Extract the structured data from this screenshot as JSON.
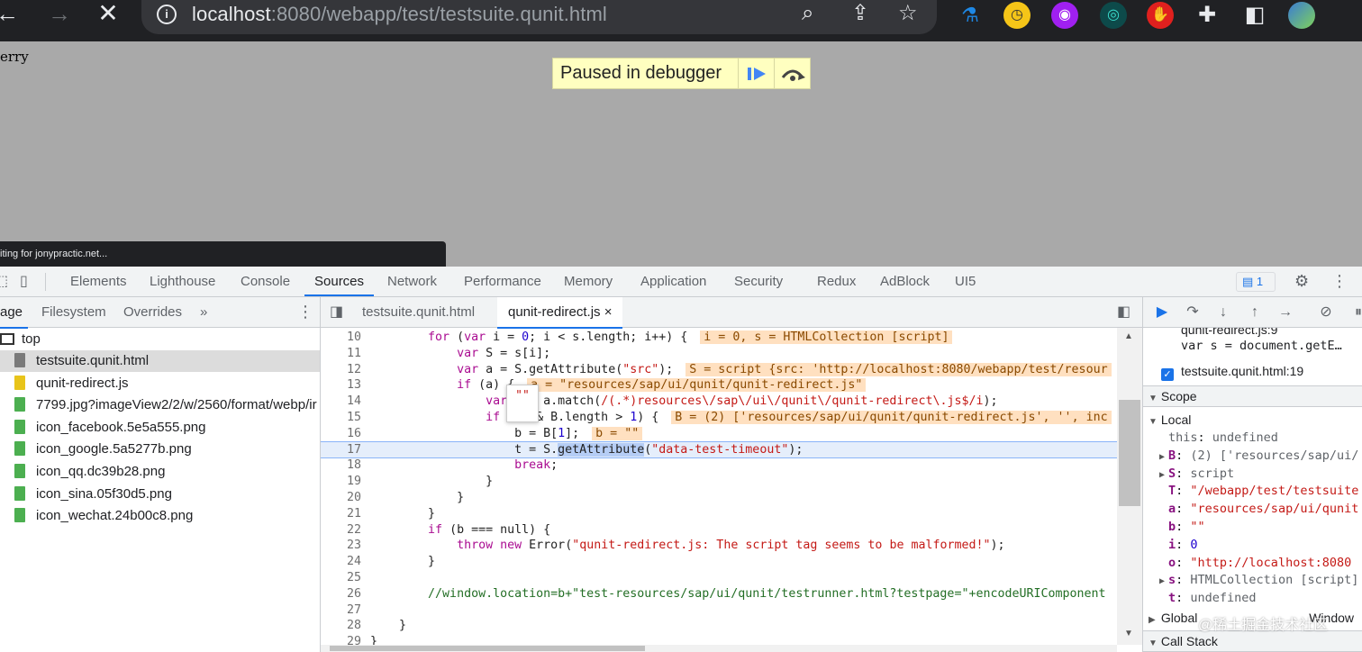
{
  "browser": {
    "url_host": "localhost",
    "url_rest": ":8080/webapp/test/testsuite.qunit.html",
    "back_icon": "back-arrow-icon",
    "forward_icon": "forward-arrow-icon",
    "stop_icon": "close-icon"
  },
  "page": {
    "text": "erry",
    "debugger_banner": "Paused in debugger",
    "status_text": "iting for jonypractic.net..."
  },
  "devtools": {
    "tabs": [
      "Elements",
      "Lighthouse",
      "Console",
      "Sources",
      "Network",
      "Performance",
      "Memory",
      "Application",
      "Security",
      "Redux",
      "AdBlock",
      "UI5"
    ],
    "active_tab": "Sources",
    "issues_count": "1"
  },
  "navigator": {
    "tabs": [
      "age",
      "Filesystem",
      "Overrides",
      "»"
    ],
    "root": "top",
    "files": [
      {
        "name": "testsuite.qunit.html",
        "type": "html",
        "selected": true
      },
      {
        "name": "qunit-redirect.js",
        "type": "js",
        "selected": false
      },
      {
        "name": "7799.jpg?imageView2/2/w/2560/format/webp/ir",
        "type": "img",
        "selected": false
      },
      {
        "name": "icon_facebook.5e5a555.png",
        "type": "img",
        "selected": false
      },
      {
        "name": "icon_google.5a5277b.png",
        "type": "img",
        "selected": false
      },
      {
        "name": "icon_qq.dc39b28.png",
        "type": "img",
        "selected": false
      },
      {
        "name": "icon_sina.05f30d5.png",
        "type": "img",
        "selected": false
      },
      {
        "name": "icon_wechat.24b00c8.png",
        "type": "img",
        "selected": false
      }
    ]
  },
  "editor": {
    "tabs": [
      "testsuite.qunit.html",
      "qunit-redirect.js"
    ],
    "active_tab": "qunit-redirect.js",
    "close_glyph": "×",
    "tooltip": "\"\"",
    "lines": [
      {
        "n": "10",
        "code": "        for (var i = 0; i < s.length; i++) {",
        "inline": "i = 0, s = HTMLCollection [script]"
      },
      {
        "n": "11",
        "code": "            var S = s[i];",
        "inline": ""
      },
      {
        "n": "12",
        "code": "            var a = S.getAttribute(\"src\");",
        "inline": "S = script {src: 'http://localhost:8080/webapp/test/resour"
      },
      {
        "n": "13",
        "code": "            if (a) {",
        "inline": "a = \"resources/sap/ui/qunit/qunit-redirect.js\""
      },
      {
        "n": "14",
        "code": "                var B = a.match(/(.*)resources\\/sap\\/ui\\/qunit\\/qunit-redirect\\.js$/i);",
        "inline": ""
      },
      {
        "n": "15",
        "code": "                if (B && B.length > 1) {",
        "inline": "B = (2) ['resources/sap/ui/qunit/qunit-redirect.js', '', inc"
      },
      {
        "n": "16",
        "code": "                    b = B[1];",
        "inline": "b = \"\""
      },
      {
        "n": "17",
        "code": "                    t = S.getAttribute(\"data-test-timeout\");",
        "inline": ""
      },
      {
        "n": "18",
        "code": "                    break;",
        "inline": ""
      },
      {
        "n": "19",
        "code": "                }",
        "inline": ""
      },
      {
        "n": "20",
        "code": "            }",
        "inline": ""
      },
      {
        "n": "21",
        "code": "        }",
        "inline": ""
      },
      {
        "n": "22",
        "code": "        if (b === null) {",
        "inline": ""
      },
      {
        "n": "23",
        "code": "            throw new Error(\"qunit-redirect.js: The script tag seems to be malformed!\");",
        "inline": ""
      },
      {
        "n": "24",
        "code": "        }",
        "inline": ""
      },
      {
        "n": "25",
        "code": "",
        "inline": ""
      },
      {
        "n": "26",
        "code": "        //window.location=b+\"test-resources/sap/ui/qunit/testrunner.html?testpage=\"+encodeURIComponent",
        "inline": ""
      },
      {
        "n": "27",
        "code": "",
        "inline": ""
      },
      {
        "n": "28",
        "code": "    }",
        "inline": ""
      },
      {
        "n": "29",
        "code": "}",
        "inline": ""
      }
    ],
    "current_line": "17"
  },
  "debugger": {
    "callstack_prev": "qunit-redirect.js:9",
    "callstack_prev_code": "var s = document.getE…",
    "breakpoint": "testsuite.qunit.html:19",
    "scope_label": "Scope",
    "local_label": "Local",
    "scope_vars": [
      {
        "key": "this",
        "val": "undefined",
        "kind": "plain",
        "expandable": false
      },
      {
        "key": "B",
        "val": "(2) ['resources/sap/ui/",
        "kind": "plain",
        "expandable": true
      },
      {
        "key": "S",
        "val": "script",
        "kind": "plain",
        "expandable": true
      },
      {
        "key": "T",
        "val": "\"/webapp/test/testsuite",
        "kind": "str",
        "expandable": false
      },
      {
        "key": "a",
        "val": "\"resources/sap/ui/qunit",
        "kind": "str",
        "expandable": false
      },
      {
        "key": "b",
        "val": "\"\"",
        "kind": "str",
        "expandable": false
      },
      {
        "key": "i",
        "val": "0",
        "kind": "num",
        "expandable": false
      },
      {
        "key": "o",
        "val": "\"http://localhost:8080",
        "kind": "str",
        "expandable": false
      },
      {
        "key": "s",
        "val": "HTMLCollection [script]",
        "kind": "plain",
        "expandable": true
      },
      {
        "key": "t",
        "val": "undefined",
        "kind": "plain",
        "expandable": false
      }
    ],
    "global_label": "Global",
    "global_val": "Window",
    "callstack_label": "Call Stack"
  },
  "watermark": "@稀土掘金技术社区",
  "colors": {
    "accent": "#1a73e8",
    "banner": "#ffffc0",
    "page_bg": "#a9a9a9"
  }
}
